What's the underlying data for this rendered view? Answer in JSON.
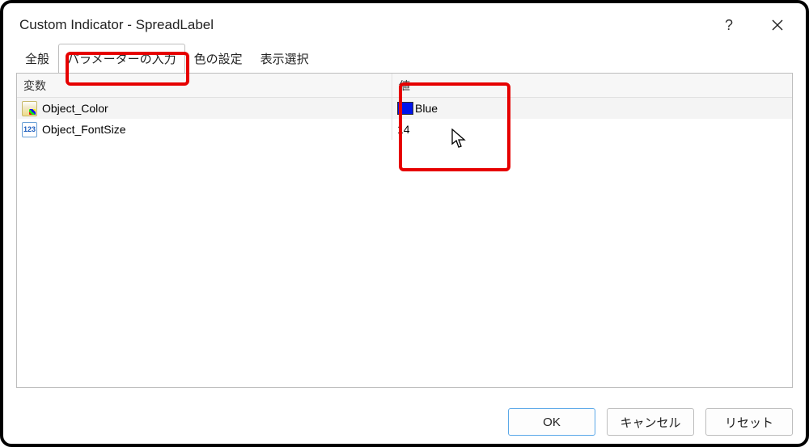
{
  "window": {
    "title": "Custom Indicator - SpreadLabel"
  },
  "tabs": [
    {
      "label": "全般"
    },
    {
      "label": "パラメーターの入力"
    },
    {
      "label": "色の設定"
    },
    {
      "label": "表示選択"
    }
  ],
  "table": {
    "header_variable": "変数",
    "header_value": "値",
    "rows": [
      {
        "name": "Object_Color",
        "value_text": "Blue",
        "value_color": "#0013ea",
        "type": "color"
      },
      {
        "name": "Object_FontSize",
        "value_text": "14",
        "type": "number"
      }
    ]
  },
  "buttons": {
    "ok": "OK",
    "cancel": "キャンセル",
    "reset": "リセット"
  }
}
